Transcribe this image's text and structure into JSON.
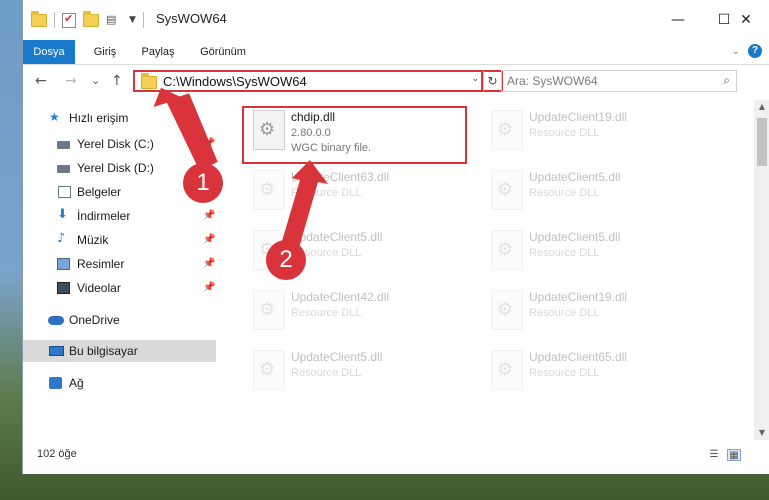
{
  "window": {
    "title": "SysWOW64",
    "controls": {
      "minimize": "—",
      "maximize": "☐",
      "close": "✕"
    }
  },
  "ribbon": {
    "tabs": [
      "Dosya",
      "Giriş",
      "Paylaş",
      "Görünüm"
    ]
  },
  "nav": {
    "back": "←",
    "forward": "→",
    "recent": "⌄",
    "up": "↑",
    "address": "C:\\Windows\\SysWOW64",
    "refresh": "↻",
    "search_placeholder": "Ara: SysWOW64",
    "search_icon": "⌕"
  },
  "sidebar": {
    "items": [
      {
        "label": "Hızlı erişim",
        "icon": "star-icon"
      },
      {
        "label": "Yerel Disk (C:)",
        "icon": "drive-icon",
        "pinned": true
      },
      {
        "label": "Yerel Disk (D:)",
        "icon": "drive-icon"
      },
      {
        "label": "Belgeler",
        "icon": "documents-icon"
      },
      {
        "label": "İndirmeler",
        "icon": "download-icon",
        "pinned": true
      },
      {
        "label": "Müzik",
        "icon": "music-icon",
        "pinned": true
      },
      {
        "label": "Resimler",
        "icon": "pictures-icon",
        "pinned": true
      },
      {
        "label": "Videolar",
        "icon": "videos-icon",
        "pinned": true
      },
      {
        "label": "OneDrive",
        "icon": "cloud-icon"
      },
      {
        "label": "Bu bilgisayar",
        "icon": "computer-icon",
        "selected": true
      },
      {
        "label": "Ağ",
        "icon": "network-icon"
      }
    ]
  },
  "files": [
    {
      "name": "chdip.dll",
      "version": "2.80.0.0",
      "type": "WGC binary file.",
      "highlighted": true
    },
    {
      "name": "UpdateClient19.dll",
      "type": "Resource DLL"
    },
    {
      "name": "UpdateClient63.dll",
      "type": "Resource DLL"
    },
    {
      "name": "UpdateClient5.dll",
      "type": "Resource DLL"
    },
    {
      "name": "UpdateClient5.dll",
      "type": "Resource DLL"
    },
    {
      "name": "UpdateClient5.dll",
      "type": "Resource DLL"
    },
    {
      "name": "UpdateClient42.dll",
      "type": "Resource DLL"
    },
    {
      "name": "UpdateClient19.dll",
      "type": "Resource DLL"
    },
    {
      "name": "UpdateClient5.dll",
      "type": "Resource DLL"
    },
    {
      "name": "UpdateClient65.dll",
      "type": "Resource DLL"
    }
  ],
  "status": {
    "item_count": "102 öğe"
  },
  "annotations": {
    "step1": "1",
    "step2": "2",
    "color": "#d9343b"
  }
}
